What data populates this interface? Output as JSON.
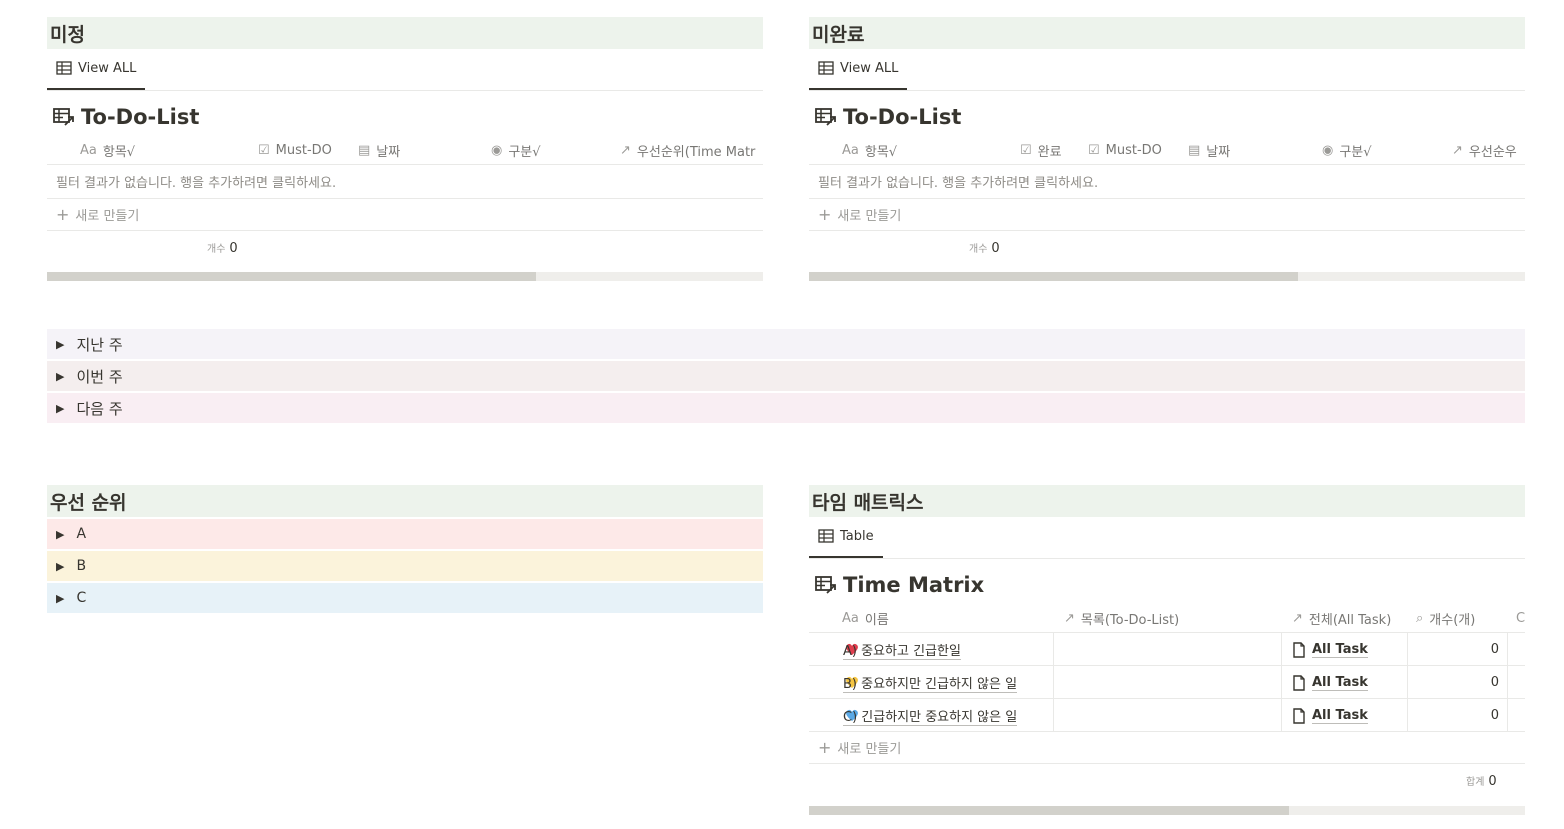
{
  "pending": {
    "header": "미정",
    "tab": "View ALL",
    "db_title": "To-Do-List",
    "columns": [
      "항목√",
      "Must-DO",
      "날짜",
      "구분√",
      "우선순위(Time Matr"
    ],
    "empty_message": "필터 결과가 없습니다. 행을 추가하려면 클릭하세요.",
    "new_label": "새로 만들기",
    "count_label": "개수",
    "count_value": "0"
  },
  "incomplete": {
    "header": "미완료",
    "tab": "View ALL",
    "db_title": "To-Do-List",
    "columns": [
      "항목√",
      "완료",
      "Must-DO",
      "날짜",
      "구분√",
      "우선순우"
    ],
    "empty_message": "필터 결과가 없습니다. 행을 추가하려면 클릭하세요.",
    "new_label": "새로 만들기",
    "count_label": "개수",
    "count_value": "0"
  },
  "week_toggles": [
    {
      "label": "지난 주",
      "color": "#f5f3f8"
    },
    {
      "label": "이번 주",
      "color": "#f4eeee"
    },
    {
      "label": "다음 주",
      "color": "#f9eef3"
    }
  ],
  "priority": {
    "header": "우선 순위",
    "items": [
      {
        "label": "A",
        "color": "#fde9e8"
      },
      {
        "label": "B",
        "color": "#fbf3db"
      },
      {
        "label": "C",
        "color": "#e7f2f8"
      }
    ]
  },
  "time_matrix": {
    "header": "타임 매트릭스",
    "tab": "Table",
    "db_title": "Time Matrix",
    "columns": [
      "이름",
      "목록(To-Do-List)",
      "전체(All Task)",
      "개수(개)"
    ],
    "rows": [
      {
        "name": "A) 중요하고 긴급한일",
        "heart": "red",
        "all_task": "All Task",
        "count": "0"
      },
      {
        "name": "B) 중요하지만 긴급하지 않은 일",
        "heart": "yellow",
        "all_task": "All Task",
        "count": "0"
      },
      {
        "name": "C) 긴급하지만 중요하지 않은 일",
        "heart": "blue",
        "all_task": "All Task",
        "count": "0"
      }
    ],
    "new_label": "새로 만들기",
    "sum_label": "합계",
    "sum_value": "0"
  },
  "colors": {
    "section_header_bg": "#edf3ec",
    "heart_red": "#e03e4e",
    "heart_yellow": "#f5c542",
    "heart_blue": "#5aa9e6"
  }
}
